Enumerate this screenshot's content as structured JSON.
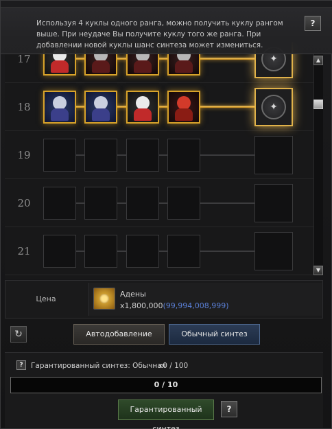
{
  "tooltip": {
    "text": "Используя 4 куклы одного ранга, можно получить куклу рангом выше. При неудаче Вы получите куклу того же ранга. При добавлении новой куклы шанс синтеза может измениться.",
    "help_icon": "help-book-icon"
  },
  "rows": [
    {
      "num": "17",
      "filled": true,
      "dolls": [
        "white",
        "dark",
        "dark",
        "dark"
      ],
      "active": true
    },
    {
      "num": "18",
      "filled": true,
      "dolls": [
        "blue",
        "blue",
        "white",
        "red"
      ],
      "active": true
    },
    {
      "num": "19",
      "filled": false
    },
    {
      "num": "20",
      "filled": false
    },
    {
      "num": "21",
      "filled": false
    }
  ],
  "price": {
    "label": "Цена",
    "currency": "Адены",
    "cost": "x1,800,000",
    "owned": "(99,994,008,999)",
    "icon": "adena-coin-icon"
  },
  "buttons": {
    "refresh_icon": "refresh-icon",
    "auto": "Автодобавление",
    "normal": "Обычный синтез",
    "guaranteed": "Гарантированный синтез"
  },
  "guarantee": {
    "label": "Гарантированный синтез: Обычная",
    "count": "x0 / 100",
    "progress_text": "0 / 10",
    "progress": 0.0
  },
  "colors": {
    "gold": "#d8a32a",
    "owned_blue": "#5a7fd6",
    "normal_btn": "#2c3c55",
    "guar_btn": "#2f4a2a"
  }
}
